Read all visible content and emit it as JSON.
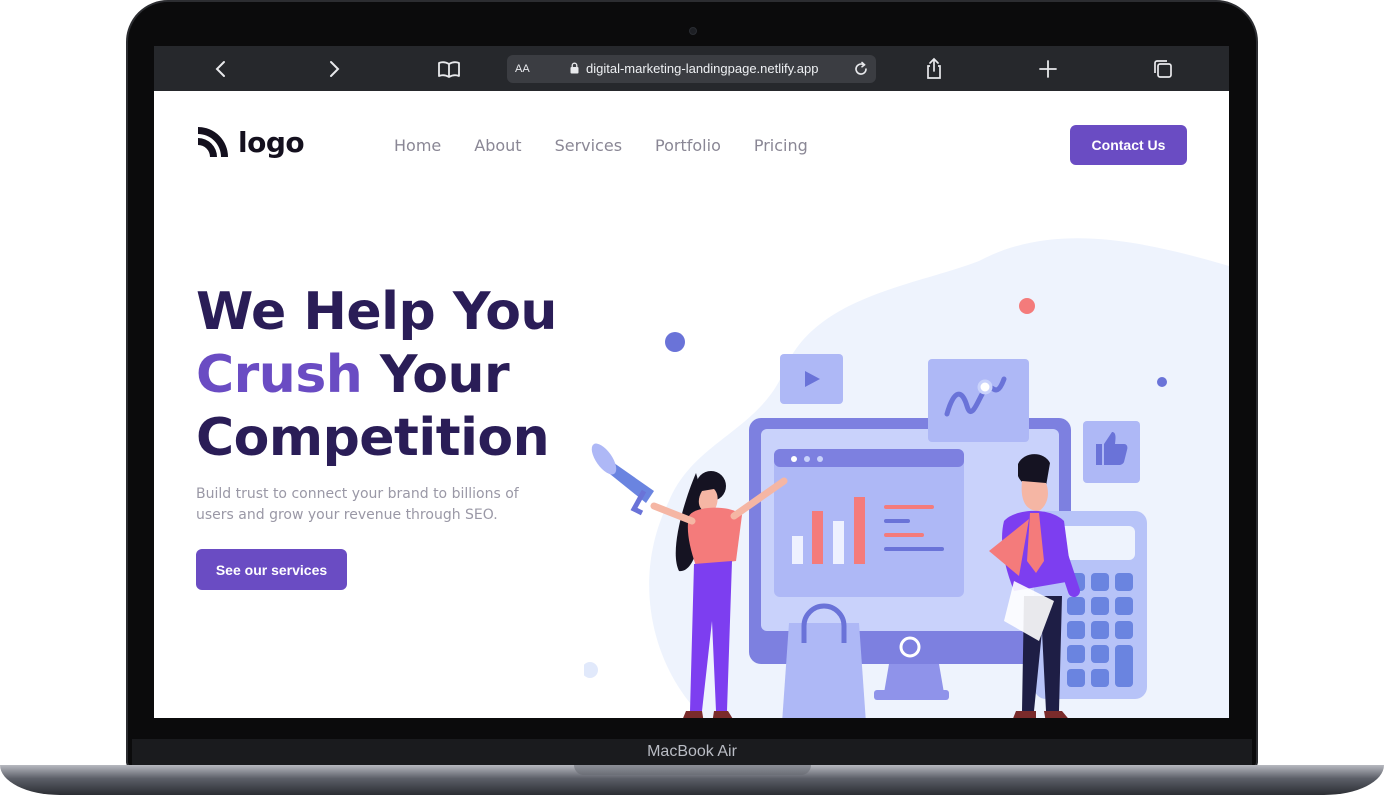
{
  "device": {
    "model": "MacBook Air"
  },
  "browser": {
    "text_size_label": "AA",
    "url": "digital-marketing-landingpage.netlify.app"
  },
  "site": {
    "logo_text": "logo",
    "nav": [
      "Home",
      "About",
      "Services",
      "Portfolio",
      "Pricing"
    ],
    "contact_label": "Contact Us"
  },
  "hero": {
    "title_line1": "We Help You",
    "title_accent": "Crush",
    "title_line2_rest": " Your",
    "title_line3": "Competition",
    "subtitle": "Build trust to connect your brand to billions of users and grow your revenue through SEO.",
    "cta_label": "See our services"
  },
  "colors": {
    "brand": "#6a4cc3",
    "title": "#2a1d57",
    "text_muted": "#9a98a6",
    "browser_bar": "#26282c"
  }
}
